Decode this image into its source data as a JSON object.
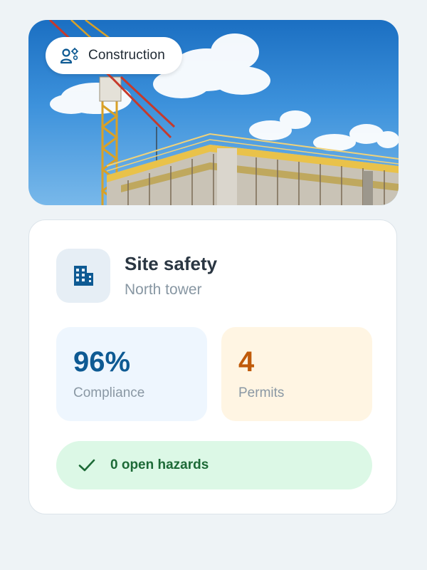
{
  "hero": {
    "category_label": "Construction",
    "category_icon": "worker-gears-icon",
    "image_subject": "building-under-construction-with-crane"
  },
  "site": {
    "icon": "building-icon",
    "title": "Site safety",
    "subtitle": "North tower"
  },
  "stats": [
    {
      "value": "96%",
      "label": "Compliance",
      "accent": "#0E5A93"
    },
    {
      "value": "4",
      "label": "Permits",
      "accent": "#C05A0A"
    }
  ],
  "hazards": {
    "icon": "check-icon",
    "text": "0 open hazards"
  },
  "colors": {
    "page_bg": "#EEF3F6",
    "card_bg": "#FFFFFF",
    "blue_tile": "#EEF6FE",
    "amber_tile": "#FFF5E3",
    "green_pill": "#DCF8E6",
    "green_text": "#1D6A37"
  }
}
